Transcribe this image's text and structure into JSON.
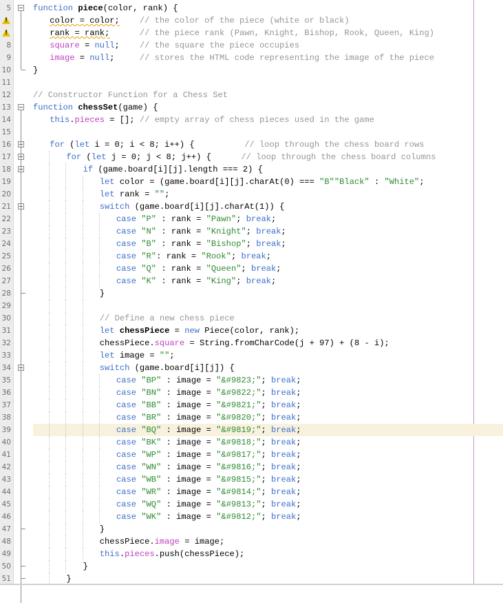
{
  "editor": {
    "highlighted_line": 39,
    "warning_lines": [
      6,
      7
    ],
    "lines": [
      {
        "n": "5",
        "indent": 0,
        "fold": "open",
        "tokens": [
          [
            "kw",
            "function "
          ],
          [
            "fn",
            "piece"
          ],
          [
            "",
            "(color, rank) {"
          ]
        ]
      },
      {
        "n": "6",
        "indent": 1,
        "warn": true,
        "tokens": [
          [
            "squig",
            "color = color;"
          ],
          [
            "",
            "    "
          ],
          [
            "cm",
            "// the color of the piece (white or black)"
          ]
        ]
      },
      {
        "n": "7",
        "indent": 1,
        "warn": true,
        "tokens": [
          [
            "squig",
            "rank = rank;"
          ],
          [
            "",
            "      "
          ],
          [
            "cm",
            "// the piece rank (Pawn, Knight, Bishop, Rook, Queen, King)"
          ]
        ]
      },
      {
        "n": "8",
        "indent": 1,
        "tokens": [
          [
            "prop",
            "square"
          ],
          [
            "",
            " = "
          ],
          [
            "kw",
            "null"
          ],
          [
            "",
            ";    "
          ],
          [
            "cm",
            "// the square the piece occupies"
          ]
        ]
      },
      {
        "n": "9",
        "indent": 1,
        "tokens": [
          [
            "prop",
            "image"
          ],
          [
            "",
            " = "
          ],
          [
            "kw",
            "null"
          ],
          [
            "",
            ";     "
          ],
          [
            "cm",
            "// stores the HTML code representing the image of the piece"
          ]
        ]
      },
      {
        "n": "10",
        "indent": 0,
        "fold": "end",
        "tokens": [
          [
            "",
            "}"
          ]
        ]
      },
      {
        "n": "11",
        "indent": 0,
        "tokens": []
      },
      {
        "n": "12",
        "indent": 0,
        "tokens": [
          [
            "cm",
            "// Constructor Function for a Chess Set"
          ]
        ]
      },
      {
        "n": "13",
        "indent": 0,
        "fold": "open",
        "tokens": [
          [
            "kw",
            "function "
          ],
          [
            "fn",
            "chessSet"
          ],
          [
            "",
            "(game) {"
          ]
        ]
      },
      {
        "n": "14",
        "indent": 1,
        "tokens": [
          [
            "kw",
            "this"
          ],
          [
            "",
            "."
          ],
          [
            "prop",
            "pieces"
          ],
          [
            "",
            " = []; "
          ],
          [
            "cm",
            "// empty array of chess pieces used in the game"
          ]
        ]
      },
      {
        "n": "15",
        "indent": 1,
        "tokens": []
      },
      {
        "n": "16",
        "indent": 1,
        "fold": "open",
        "tokens": [
          [
            "kw",
            "for"
          ],
          [
            "",
            " ("
          ],
          [
            "kw",
            "let"
          ],
          [
            "",
            " i = 0; i < 8; i++) {          "
          ],
          [
            "cm",
            "// loop through the chess board rows"
          ]
        ]
      },
      {
        "n": "17",
        "indent": 2,
        "fold": "open",
        "tokens": [
          [
            "kw",
            "for"
          ],
          [
            "",
            " ("
          ],
          [
            "kw",
            "let"
          ],
          [
            "",
            " j = 0; j < 8; j++) {      "
          ],
          [
            "cm",
            "// loop through the chess board columns"
          ]
        ]
      },
      {
        "n": "18",
        "indent": 3,
        "fold": "open",
        "tokens": [
          [
            "kw",
            "if"
          ],
          [
            "",
            " (game.board[i][j].length === 2) {"
          ]
        ]
      },
      {
        "n": "19",
        "indent": 4,
        "tokens": [
          [
            "kw",
            "let"
          ],
          [
            "",
            " color = (game.board[i][j].charAt(0) === "
          ],
          [
            "str",
            "\"B\""
          ],
          [
            ") ? "
          ],
          [
            "str",
            "\"Black\""
          ],
          [
            "",
            " : "
          ],
          [
            "str",
            "\"White\""
          ],
          [
            "",
            ";"
          ]
        ]
      },
      {
        "n": "20",
        "indent": 4,
        "tokens": [
          [
            "kw",
            "let"
          ],
          [
            "",
            " rank = "
          ],
          [
            "str",
            "\"\""
          ],
          [
            "",
            ";"
          ]
        ]
      },
      {
        "n": "21",
        "indent": 4,
        "fold": "open",
        "tokens": [
          [
            "kw",
            "switch"
          ],
          [
            "",
            " (game.board[i][j].charAt(1)) {"
          ]
        ]
      },
      {
        "n": "22",
        "indent": 5,
        "tokens": [
          [
            "kw",
            "case "
          ],
          [
            "str",
            "\"P\""
          ],
          [
            "",
            " : rank = "
          ],
          [
            "str",
            "\"Pawn\""
          ],
          [
            "",
            "; "
          ],
          [
            "kw",
            "break"
          ],
          [
            "",
            ";"
          ]
        ]
      },
      {
        "n": "23",
        "indent": 5,
        "tokens": [
          [
            "kw",
            "case "
          ],
          [
            "str",
            "\"N\""
          ],
          [
            "",
            " : rank = "
          ],
          [
            "str",
            "\"Knight\""
          ],
          [
            "",
            "; "
          ],
          [
            "kw",
            "break"
          ],
          [
            "",
            ";"
          ]
        ]
      },
      {
        "n": "24",
        "indent": 5,
        "tokens": [
          [
            "kw",
            "case "
          ],
          [
            "str",
            "\"B\""
          ],
          [
            "",
            " : rank = "
          ],
          [
            "str",
            "\"Bishop\""
          ],
          [
            "",
            "; "
          ],
          [
            "kw",
            "break"
          ],
          [
            "",
            ";"
          ]
        ]
      },
      {
        "n": "25",
        "indent": 5,
        "tokens": [
          [
            "kw",
            "case "
          ],
          [
            "str",
            "\"R\""
          ],
          [
            "",
            ": rank = "
          ],
          [
            "str",
            "\"Rook\""
          ],
          [
            "",
            "; "
          ],
          [
            "kw",
            "break"
          ],
          [
            "",
            ";"
          ]
        ]
      },
      {
        "n": "26",
        "indent": 5,
        "tokens": [
          [
            "kw",
            "case "
          ],
          [
            "str",
            "\"Q\""
          ],
          [
            "",
            " : rank = "
          ],
          [
            "str",
            "\"Queen\""
          ],
          [
            "",
            "; "
          ],
          [
            "kw",
            "break"
          ],
          [
            "",
            ";"
          ]
        ]
      },
      {
        "n": "27",
        "indent": 5,
        "tokens": [
          [
            "kw",
            "case "
          ],
          [
            "str",
            "\"K\""
          ],
          [
            "",
            " : rank = "
          ],
          [
            "str",
            "\"King\""
          ],
          [
            "",
            "; "
          ],
          [
            "kw",
            "break"
          ],
          [
            "",
            ";"
          ]
        ]
      },
      {
        "n": "28",
        "indent": 4,
        "fold": "end",
        "tokens": [
          [
            "",
            "}"
          ]
        ]
      },
      {
        "n": "29",
        "indent": 4,
        "tokens": []
      },
      {
        "n": "30",
        "indent": 4,
        "tokens": [
          [
            "cm",
            "// Define a new chess piece"
          ]
        ]
      },
      {
        "n": "31",
        "indent": 4,
        "tokens": [
          [
            "kw",
            "let"
          ],
          [
            "fn",
            " chessPiece"
          ],
          [
            "",
            " = "
          ],
          [
            "kw",
            "new"
          ],
          [
            "",
            " Piece(color, rank);"
          ]
        ]
      },
      {
        "n": "32",
        "indent": 4,
        "tokens": [
          [
            "",
            "chessPiece."
          ],
          [
            "prop",
            "square"
          ],
          [
            "",
            " = String.fromCharCode(j + 97) + (8 - i);"
          ]
        ]
      },
      {
        "n": "33",
        "indent": 4,
        "tokens": [
          [
            "kw",
            "let"
          ],
          [
            "",
            " image = "
          ],
          [
            "str",
            "\"\""
          ],
          [
            "",
            ";"
          ]
        ]
      },
      {
        "n": "34",
        "indent": 4,
        "fold": "open",
        "tokens": [
          [
            "kw",
            "switch"
          ],
          [
            "",
            " (game.board[i][j]) {"
          ]
        ]
      },
      {
        "n": "35",
        "indent": 5,
        "tokens": [
          [
            "kw",
            "case "
          ],
          [
            "str",
            "\"BP\""
          ],
          [
            "",
            " : image = "
          ],
          [
            "str",
            "\"&#9823;\""
          ],
          [
            "",
            "; "
          ],
          [
            "kw",
            "break"
          ],
          [
            "",
            ";"
          ]
        ]
      },
      {
        "n": "36",
        "indent": 5,
        "tokens": [
          [
            "kw",
            "case "
          ],
          [
            "str",
            "\"BN\""
          ],
          [
            "",
            " : image = "
          ],
          [
            "str",
            "\"&#9822;\""
          ],
          [
            "",
            "; "
          ],
          [
            "kw",
            "break"
          ],
          [
            "",
            ";"
          ]
        ]
      },
      {
        "n": "37",
        "indent": 5,
        "tokens": [
          [
            "kw",
            "case "
          ],
          [
            "str",
            "\"BB\""
          ],
          [
            "",
            " : image = "
          ],
          [
            "str",
            "\"&#9821;\""
          ],
          [
            "",
            "; "
          ],
          [
            "kw",
            "break"
          ],
          [
            "",
            ";"
          ]
        ]
      },
      {
        "n": "38",
        "indent": 5,
        "tokens": [
          [
            "kw",
            "case "
          ],
          [
            "str",
            "\"BR\""
          ],
          [
            "",
            " : image = "
          ],
          [
            "str",
            "\"&#9820;\""
          ],
          [
            "",
            "; "
          ],
          [
            "kw",
            "break"
          ],
          [
            "",
            ";"
          ]
        ]
      },
      {
        "n": "39",
        "indent": 5,
        "tokens": [
          [
            "kw",
            "case "
          ],
          [
            "str",
            "\"BQ\""
          ],
          [
            "",
            " : image = "
          ],
          [
            "str",
            "\"&#9819;\""
          ],
          [
            "",
            "; "
          ],
          [
            "kw",
            "break"
          ],
          [
            "",
            ";"
          ]
        ]
      },
      {
        "n": "40",
        "indent": 5,
        "tokens": [
          [
            "kw",
            "case "
          ],
          [
            "str",
            "\"BK\""
          ],
          [
            "",
            " : image = "
          ],
          [
            "str",
            "\"&#9818;\""
          ],
          [
            "",
            "; "
          ],
          [
            "kw",
            "break"
          ],
          [
            "",
            ";"
          ]
        ]
      },
      {
        "n": "41",
        "indent": 5,
        "tokens": [
          [
            "kw",
            "case "
          ],
          [
            "str",
            "\"WP\""
          ],
          [
            "",
            " : image = "
          ],
          [
            "str",
            "\"&#9817;\""
          ],
          [
            "",
            "; "
          ],
          [
            "kw",
            "break"
          ],
          [
            "",
            ";"
          ]
        ]
      },
      {
        "n": "42",
        "indent": 5,
        "tokens": [
          [
            "kw",
            "case "
          ],
          [
            "str",
            "\"WN\""
          ],
          [
            "",
            " : image = "
          ],
          [
            "str",
            "\"&#9816;\""
          ],
          [
            "",
            "; "
          ],
          [
            "kw",
            "break"
          ],
          [
            "",
            ";"
          ]
        ]
      },
      {
        "n": "43",
        "indent": 5,
        "tokens": [
          [
            "kw",
            "case "
          ],
          [
            "str",
            "\"WB\""
          ],
          [
            "",
            " : image = "
          ],
          [
            "str",
            "\"&#9815;\""
          ],
          [
            "",
            "; "
          ],
          [
            "kw",
            "break"
          ],
          [
            "",
            ";"
          ]
        ]
      },
      {
        "n": "44",
        "indent": 5,
        "tokens": [
          [
            "kw",
            "case "
          ],
          [
            "str",
            "\"WR\""
          ],
          [
            "",
            " : image = "
          ],
          [
            "str",
            "\"&#9814;\""
          ],
          [
            "",
            "; "
          ],
          [
            "kw",
            "break"
          ],
          [
            "",
            ";"
          ]
        ]
      },
      {
        "n": "45",
        "indent": 5,
        "tokens": [
          [
            "kw",
            "case "
          ],
          [
            "str",
            "\"WQ\""
          ],
          [
            "",
            " : image = "
          ],
          [
            "str",
            "\"&#9813;\""
          ],
          [
            "",
            "; "
          ],
          [
            "kw",
            "break"
          ],
          [
            "",
            ";"
          ]
        ]
      },
      {
        "n": "46",
        "indent": 5,
        "tokens": [
          [
            "kw",
            "case "
          ],
          [
            "str",
            "\"WK\""
          ],
          [
            "",
            " : image = "
          ],
          [
            "str",
            "\"&#9812;\""
          ],
          [
            "",
            "; "
          ],
          [
            "kw",
            "break"
          ],
          [
            "",
            ";"
          ]
        ]
      },
      {
        "n": "47",
        "indent": 4,
        "fold": "end",
        "tokens": [
          [
            "",
            "}"
          ]
        ]
      },
      {
        "n": "48",
        "indent": 4,
        "tokens": [
          [
            "",
            "chessPiece."
          ],
          [
            "prop",
            "image"
          ],
          [
            "",
            " = image;"
          ]
        ]
      },
      {
        "n": "49",
        "indent": 4,
        "tokens": [
          [
            "kw",
            "this"
          ],
          [
            "",
            "."
          ],
          [
            "prop",
            "pieces"
          ],
          [
            "",
            ".push(chessPiece);"
          ]
        ]
      },
      {
        "n": "50",
        "indent": 3,
        "fold": "end",
        "tokens": [
          [
            "",
            "}"
          ]
        ]
      },
      {
        "n": "51",
        "indent": 2,
        "fold": "end",
        "tokens": [
          [
            "",
            "}"
          ]
        ]
      }
    ]
  },
  "colors": {
    "keyword": "#3d6fc9",
    "string": "#2e8b32",
    "comment": "#969696",
    "property": "#c040c0",
    "current_line": "#f8f1de",
    "margin_line": "#c896c8"
  }
}
